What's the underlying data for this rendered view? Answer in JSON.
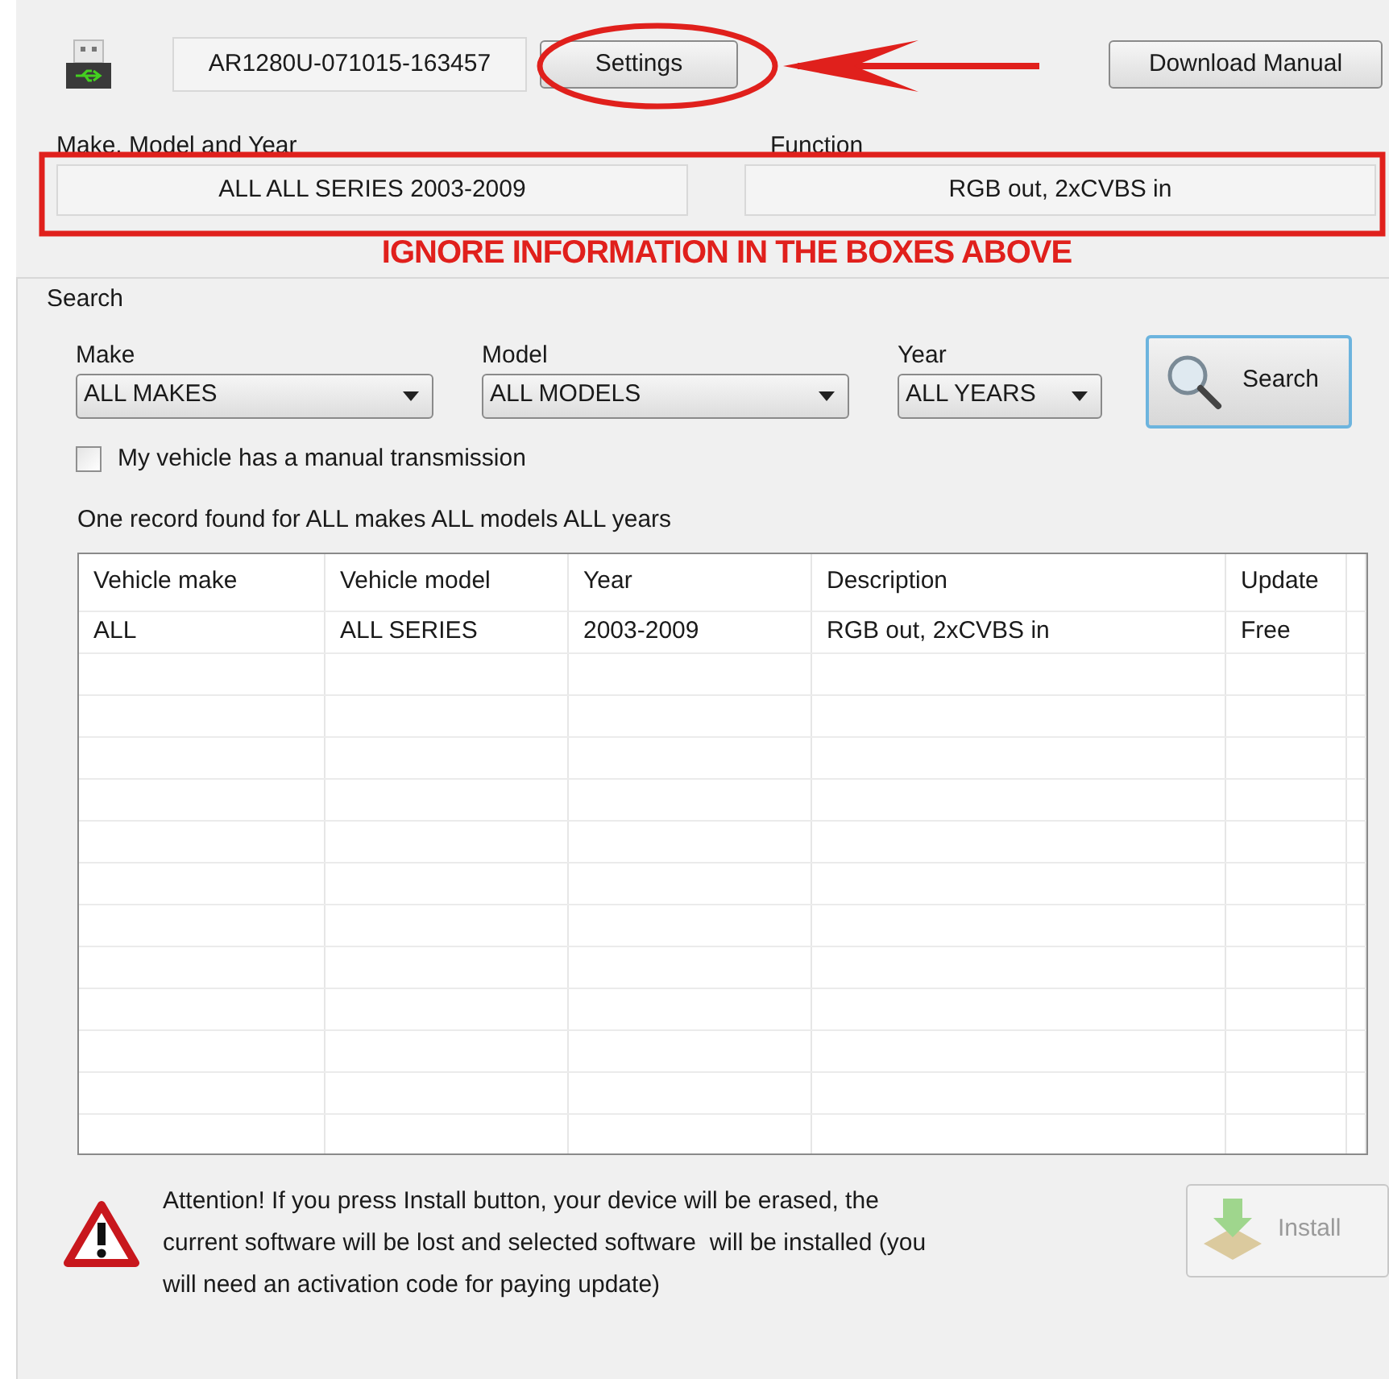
{
  "device": {
    "serial": "AR1280U-071015-163457"
  },
  "buttons": {
    "settings": "Settings",
    "download_manual": "Download Manual"
  },
  "info": [
    {
      "label": "Make, Model and Year",
      "value": "ALL ALL SERIES 2003-2009"
    },
    {
      "label": "Function",
      "value": "RGB out, 2xCVBS in"
    }
  ],
  "annotation": "IGNORE INFORMATION IN THE BOXES ABOVE",
  "search": {
    "title": "Search",
    "filters": [
      {
        "label": "Make",
        "value": "ALL MAKES"
      },
      {
        "label": "Model",
        "value": "ALL MODELS"
      },
      {
        "label": "Year",
        "value": "ALL YEARS"
      }
    ],
    "button": "Search",
    "manual_transmission": {
      "label": "My vehicle has a manual transmission",
      "checked": false
    },
    "result_summary": "One record found for ALL makes ALL models ALL years"
  },
  "table": {
    "columns": [
      "Vehicle make",
      "Vehicle model",
      "Year",
      "Description",
      "Update"
    ],
    "rows": [
      [
        "ALL",
        "ALL SERIES",
        "2003-2009",
        "RGB out, 2xCVBS in",
        "Free"
      ]
    ]
  },
  "warning": "Attention! If you press Install button, your device will be erased, the current software will be lost and selected software  will be installed (you will need an activation code for paying update)",
  "install": {
    "label": "Install",
    "disabled": true
  }
}
